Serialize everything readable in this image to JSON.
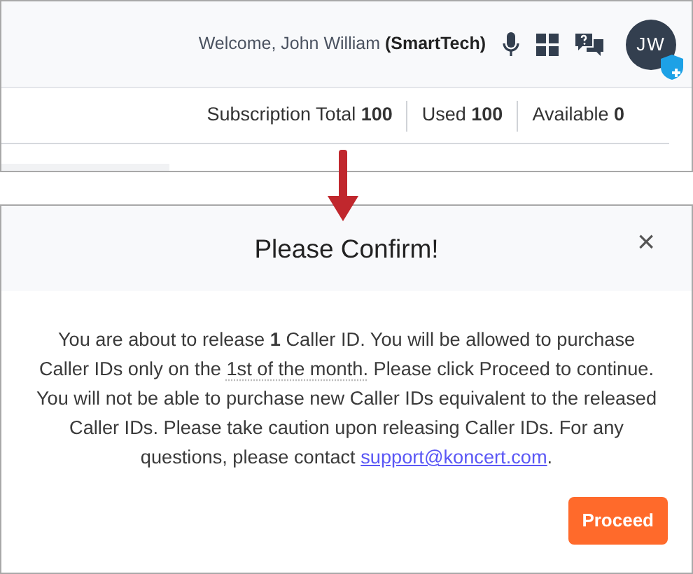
{
  "header": {
    "welcome": "Welcome, John William",
    "company": "(SmartTech)",
    "avatar_initials": "JW"
  },
  "subscription": [
    {
      "label": "Subscription Total",
      "value": "100"
    },
    {
      "label": "Used",
      "value": "100"
    },
    {
      "label": "Available",
      "value": "0"
    }
  ],
  "dialog": {
    "title": "Please Confirm!",
    "close": "×",
    "message": [
      {
        "kind": "text",
        "text": "You are about to release "
      },
      {
        "kind": "bold",
        "text": "1"
      },
      {
        "kind": "text",
        "text": " Caller ID. You will be allowed to purchase Caller IDs only on the "
      },
      {
        "kind": "term",
        "text": "1st of the month."
      },
      {
        "kind": "text",
        "text": " Please click Proceed to continue. You will not be able to purchase new Caller IDs equivalent to the released Caller IDs. Please take caution upon releasing Caller IDs. For any questions, please contact "
      },
      {
        "kind": "link",
        "text": "support@koncert.com"
      },
      {
        "kind": "text",
        "text": "."
      }
    ],
    "button": "Proceed"
  }
}
